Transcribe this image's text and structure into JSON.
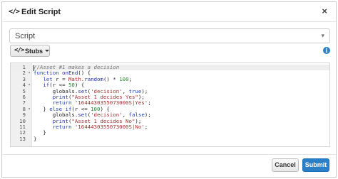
{
  "dialog": {
    "title_icon": "</>",
    "title": "Edit Script",
    "close_label": "×"
  },
  "script_select": {
    "value": "Script",
    "caret": "▾"
  },
  "stubs": {
    "icon": "</>",
    "label": "Stubs"
  },
  "info_icon": "i",
  "editor": {
    "lines": [
      {
        "num": "1",
        "fold": "",
        "active": true,
        "tokens": [
          [
            "c",
            "//Asset #1 makes a decision"
          ]
        ]
      },
      {
        "num": "2",
        "fold": "▾",
        "active": false,
        "tokens": [
          [
            "k",
            "function "
          ],
          [
            "f",
            "onEnd"
          ],
          [
            "",
            "() {"
          ]
        ]
      },
      {
        "num": "3",
        "fold": "",
        "active": false,
        "tokens": [
          [
            "",
            "   "
          ],
          [
            "k",
            "let "
          ],
          [
            "",
            "r = "
          ],
          [
            "v",
            "Math"
          ],
          [
            "",
            "."
          ],
          [
            "f",
            "random"
          ],
          [
            "",
            "() * "
          ],
          [
            "n",
            "100"
          ],
          [
            "",
            ";"
          ]
        ]
      },
      {
        "num": "4",
        "fold": "▾",
        "active": false,
        "tokens": [
          [
            "",
            "   "
          ],
          [
            "k",
            "if"
          ],
          [
            "",
            "(r <= "
          ],
          [
            "n",
            "50"
          ],
          [
            "",
            ") {"
          ]
        ]
      },
      {
        "num": "5",
        "fold": "",
        "active": false,
        "tokens": [
          [
            "",
            "      globals."
          ],
          [
            "f",
            "set"
          ],
          [
            "",
            "("
          ],
          [
            "s",
            "'decision'"
          ],
          [
            "",
            ", "
          ],
          [
            "b",
            "true"
          ],
          [
            "",
            ");"
          ]
        ]
      },
      {
        "num": "6",
        "fold": "",
        "active": false,
        "tokens": [
          [
            "",
            "      "
          ],
          [
            "f",
            "print"
          ],
          [
            "",
            "("
          ],
          [
            "s",
            "\"Asset 1 decides Yes\""
          ],
          [
            "",
            ");"
          ]
        ]
      },
      {
        "num": "7",
        "fold": "",
        "active": false,
        "tokens": [
          [
            "",
            "      "
          ],
          [
            "k",
            "return "
          ],
          [
            "s",
            "'1644430355073000S|Yes'"
          ],
          [
            "",
            ";"
          ]
        ]
      },
      {
        "num": "8",
        "fold": "▾",
        "active": false,
        "tokens": [
          [
            "",
            "   } "
          ],
          [
            "k",
            "else if"
          ],
          [
            "",
            "(r <= "
          ],
          [
            "n",
            "100"
          ],
          [
            "",
            ") {"
          ]
        ]
      },
      {
        "num": "9",
        "fold": "",
        "active": false,
        "tokens": [
          [
            "",
            "      globals."
          ],
          [
            "f",
            "set"
          ],
          [
            "",
            "("
          ],
          [
            "s",
            "'decision'"
          ],
          [
            "",
            ", "
          ],
          [
            "b",
            "false"
          ],
          [
            "",
            ");"
          ]
        ]
      },
      {
        "num": "10",
        "fold": "",
        "active": false,
        "tokens": [
          [
            "",
            "      "
          ],
          [
            "f",
            "print"
          ],
          [
            "",
            "("
          ],
          [
            "s",
            "\"Asset 1 decides No\""
          ],
          [
            "",
            ");"
          ]
        ]
      },
      {
        "num": "11",
        "fold": "",
        "active": false,
        "tokens": [
          [
            "",
            "      "
          ],
          [
            "k",
            "return "
          ],
          [
            "s",
            "'1644430355073000S|No'"
          ],
          [
            "",
            ";"
          ]
        ]
      },
      {
        "num": "12",
        "fold": "",
        "active": false,
        "tokens": [
          [
            "",
            "   }"
          ]
        ]
      },
      {
        "num": "13",
        "fold": "",
        "active": false,
        "tokens": [
          [
            "",
            "}"
          ]
        ]
      }
    ]
  },
  "footer": {
    "cancel_label": "Cancel",
    "submit_label": "Submit"
  }
}
